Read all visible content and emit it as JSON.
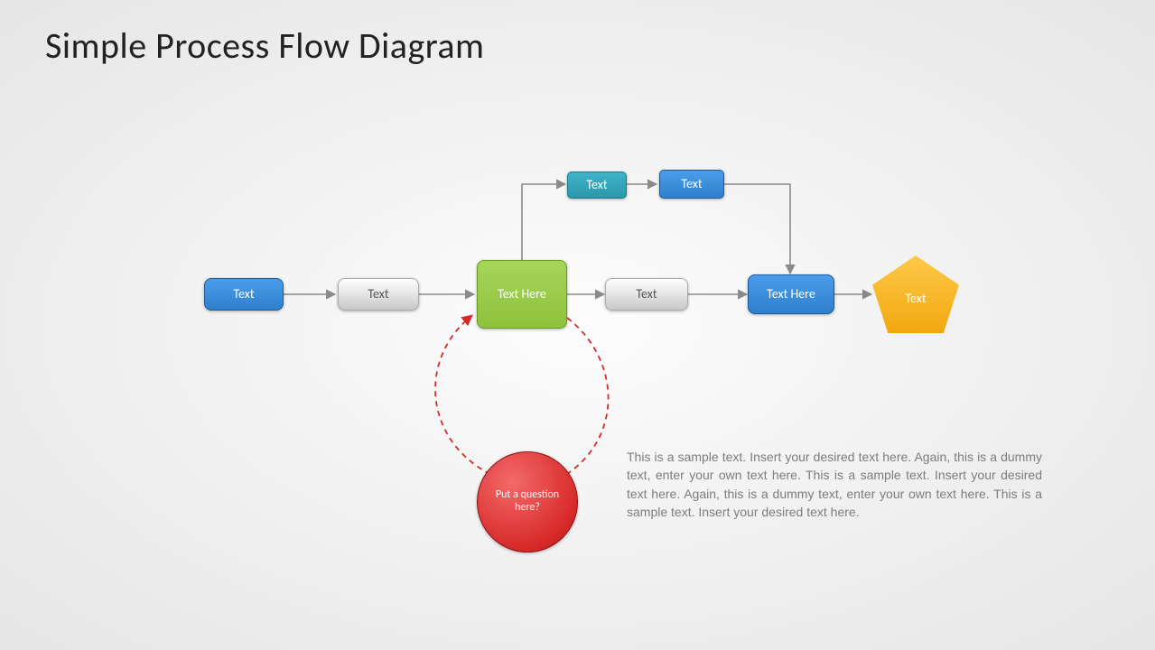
{
  "title": "Simple Process Flow Diagram",
  "nodes": {
    "n1": {
      "label": "Text"
    },
    "n2": {
      "label": "Text"
    },
    "n3": {
      "label": "Text Here"
    },
    "n4": {
      "label": "Text"
    },
    "n5": {
      "label": "Text Here"
    },
    "n6": {
      "label": "Text"
    },
    "t1": {
      "label": "Text"
    },
    "t2": {
      "label": "Text"
    },
    "q": {
      "label": "Put a question here?"
    }
  },
  "body_text": "This is a sample text. Insert your desired text here. Again, this is a dummy text, enter your own text here. This is a sample text. Insert your desired text here. Again, this is a dummy text, enter your own text here. This is a sample text. Insert your desired text here."
}
